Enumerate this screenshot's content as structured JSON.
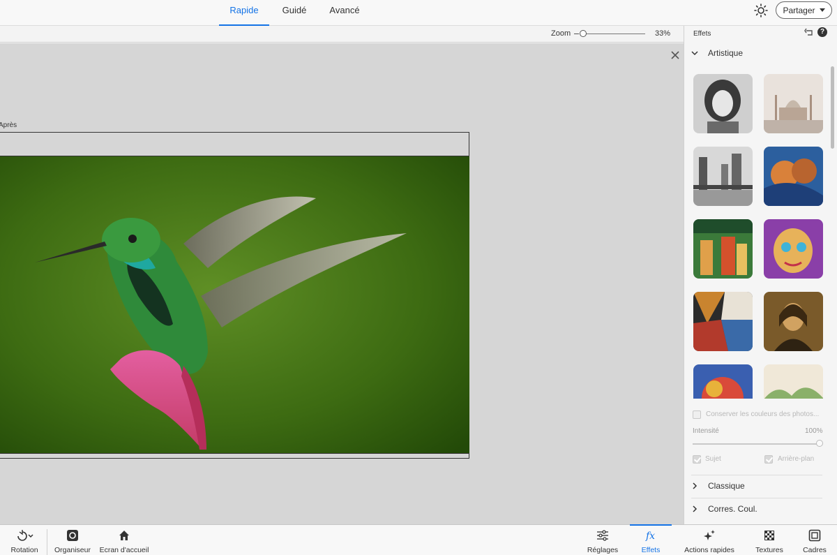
{
  "header": {
    "tabs": [
      {
        "label": "Rapide",
        "active": true
      },
      {
        "label": "Guidé",
        "active": false
      },
      {
        "label": "Avancé",
        "active": false
      }
    ],
    "share_label": "Partager"
  },
  "zoom": {
    "label": "Zoom",
    "value_text": "33%",
    "level": 0.33
  },
  "canvas": {
    "view_label": "Après"
  },
  "panel": {
    "title": "Effets",
    "sections": {
      "artistic": "Artistique",
      "classic": "Classique",
      "color": "Corres. Coul."
    },
    "keep_colors_label": "Conserver les couleurs des photos...",
    "intensity_label": "Intensité",
    "intensity_value": "100%",
    "intensity_level": 1.0,
    "subject_label": "Sujet",
    "background_label": "Arrière-plan"
  },
  "bottom_bar": {
    "rotation": "Rotation",
    "organizer": "Organiseur",
    "home": "Ecran d'accueil",
    "adjustments": "Réglages",
    "effects": "Effets",
    "quick_actions": "Actions rapides",
    "textures": "Textures",
    "frames": "Cadres"
  },
  "colors": {
    "accent": "#1473e6"
  }
}
